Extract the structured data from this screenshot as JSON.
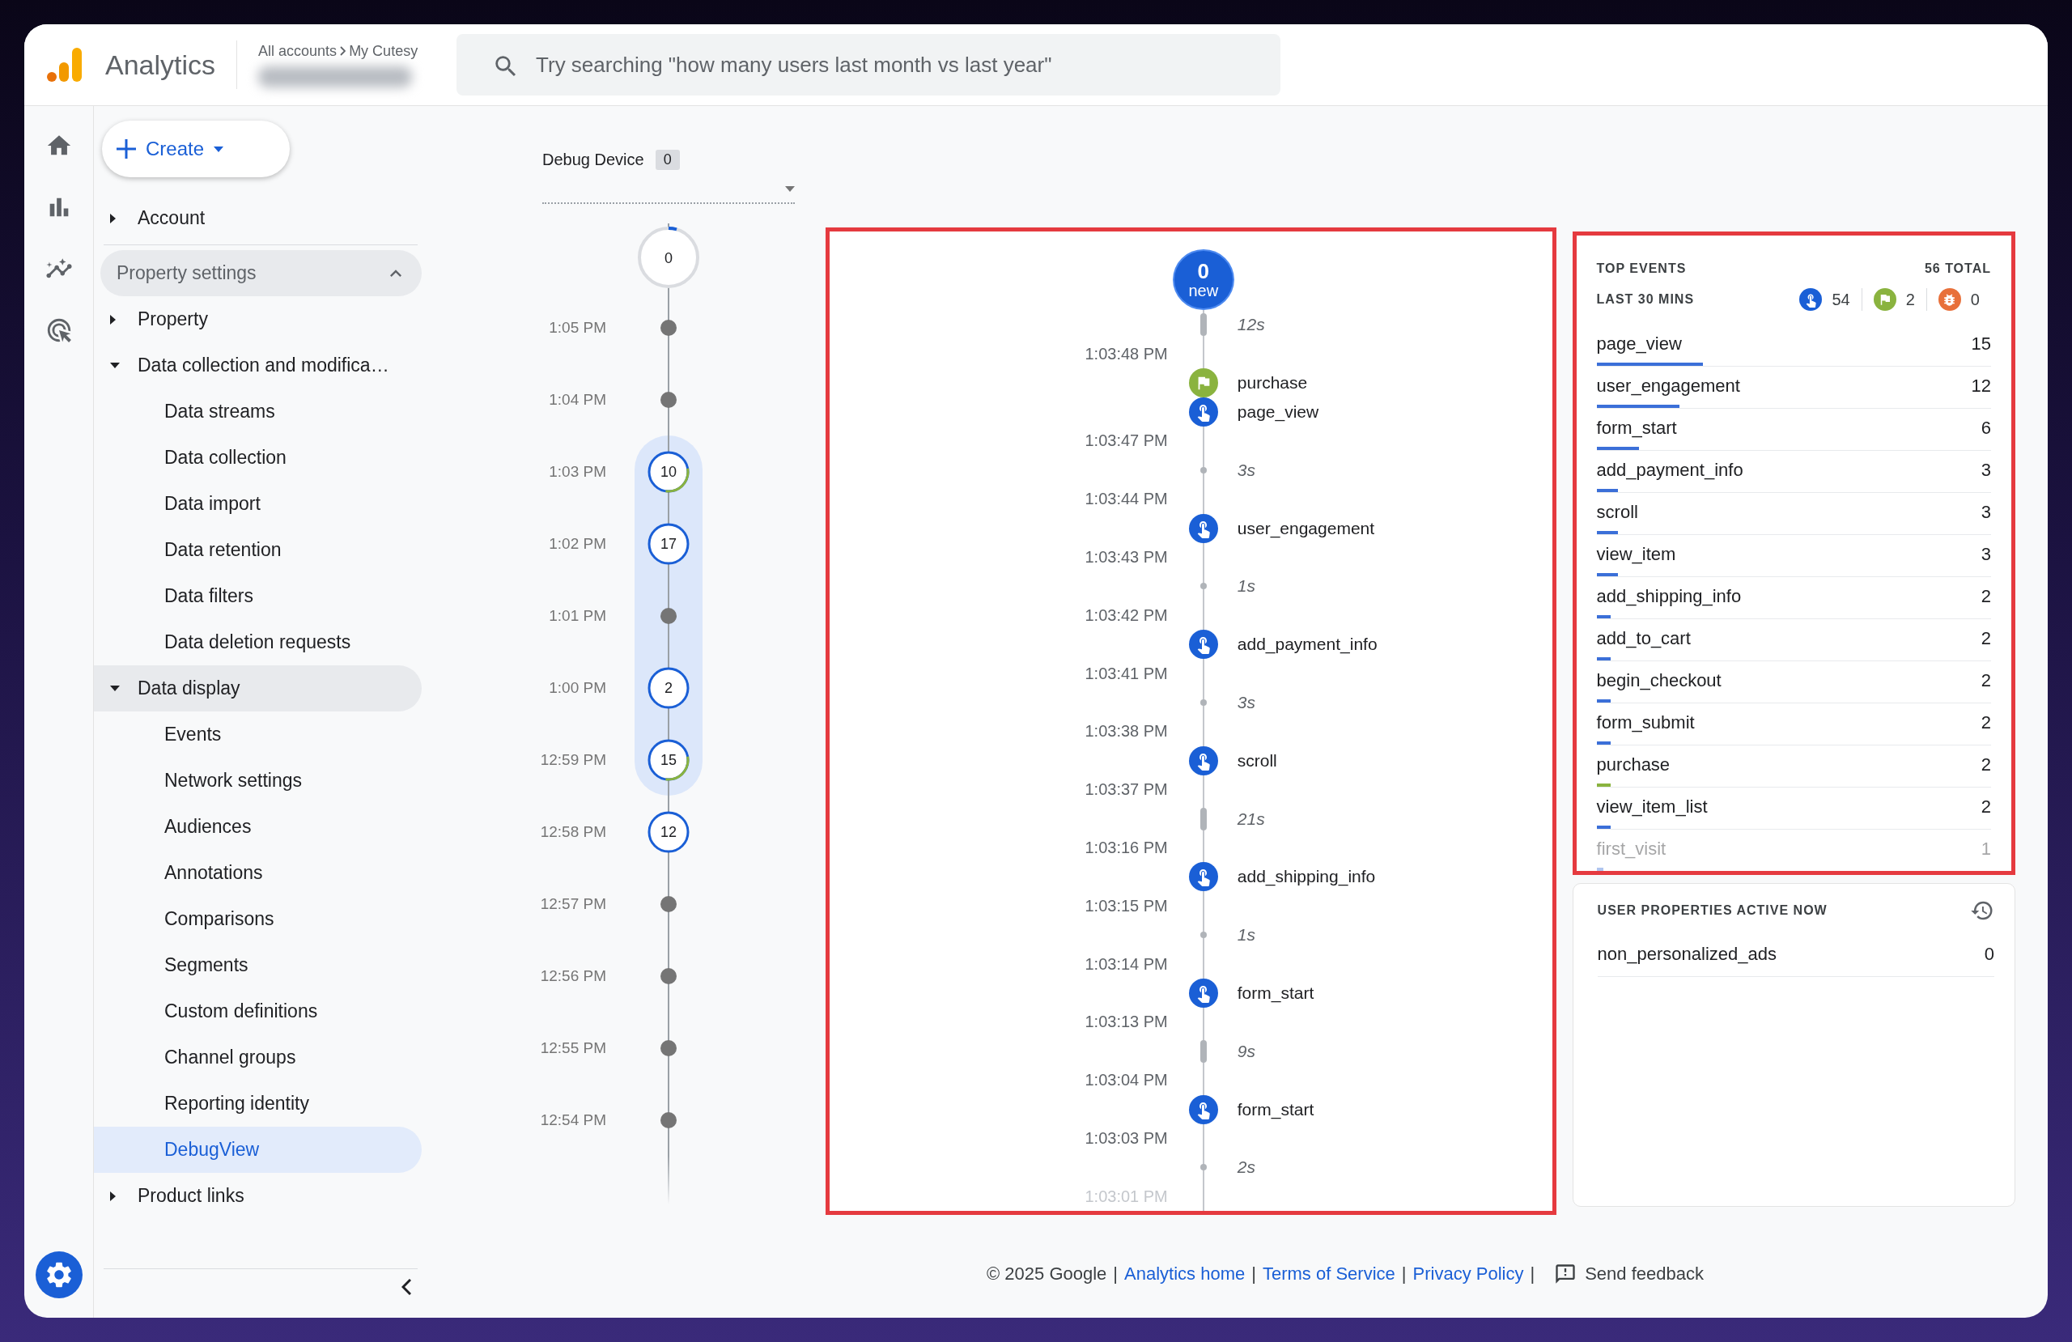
{
  "header": {
    "product": "Analytics",
    "breadcrumb": [
      "All accounts",
      "My Cutesy"
    ],
    "search": {
      "placeholder": "Try searching \"how many users last month vs last year\""
    }
  },
  "sidebar": {
    "create_button": "Create",
    "items": [
      {
        "label": "Account",
        "kind": "node",
        "expanded": false
      },
      {
        "label": "Property settings",
        "kind": "section",
        "expanded": true,
        "children": [
          {
            "label": "Property",
            "kind": "node",
            "expanded": false
          },
          {
            "label": "Data collection and modifica…",
            "kind": "node",
            "expanded": true,
            "children": [
              {
                "label": "Data streams",
                "kind": "leaf",
                "selected": false
              },
              {
                "label": "Data collection",
                "kind": "leaf",
                "selected": false
              },
              {
                "label": "Data import",
                "kind": "leaf",
                "selected": false
              },
              {
                "label": "Data retention",
                "kind": "leaf",
                "selected": false
              },
              {
                "label": "Data filters",
                "kind": "leaf",
                "selected": false
              },
              {
                "label": "Data deletion requests",
                "kind": "leaf",
                "selected": false
              }
            ]
          },
          {
            "label": "Data display",
            "kind": "node",
            "expanded": true,
            "highlighted": true,
            "children": [
              {
                "label": "Events",
                "kind": "leaf",
                "selected": false
              },
              {
                "label": "Network settings",
                "kind": "leaf",
                "selected": false
              },
              {
                "label": "Audiences",
                "kind": "leaf",
                "selected": false
              },
              {
                "label": "Annotations",
                "kind": "leaf",
                "selected": false
              },
              {
                "label": "Comparisons",
                "kind": "leaf",
                "selected": false
              },
              {
                "label": "Segments",
                "kind": "leaf",
                "selected": false
              },
              {
                "label": "Custom definitions",
                "kind": "leaf",
                "selected": false
              },
              {
                "label": "Channel groups",
                "kind": "leaf",
                "selected": false
              },
              {
                "label": "Reporting identity",
                "kind": "leaf",
                "selected": false
              },
              {
                "label": "DebugView",
                "kind": "leaf",
                "selected": true
              }
            ]
          },
          {
            "label": "Product links",
            "kind": "node",
            "expanded": false
          }
        ]
      }
    ]
  },
  "timeline": {
    "device_label": "Debug Device",
    "device_count": "0",
    "current": "0",
    "rows": [
      {
        "time": "1:05 PM",
        "kind": "dot",
        "highlighted": false
      },
      {
        "time": "1:04 PM",
        "kind": "dot",
        "highlighted": false
      },
      {
        "time": "1:03 PM",
        "kind": "count",
        "count": "10",
        "conversion": true,
        "highlighted": true
      },
      {
        "time": "1:02 PM",
        "kind": "count",
        "count": "17",
        "conversion": false,
        "highlighted": true
      },
      {
        "time": "1:01 PM",
        "kind": "dot",
        "highlighted": true
      },
      {
        "time": "1:00 PM",
        "kind": "count",
        "count": "2",
        "conversion": false,
        "highlighted": true
      },
      {
        "time": "12:59 PM",
        "kind": "count",
        "count": "15",
        "conversion": true,
        "highlighted": true
      },
      {
        "time": "12:58 PM",
        "kind": "count",
        "count": "12",
        "conversion": false,
        "highlighted": false
      },
      {
        "time": "12:57 PM",
        "kind": "dot",
        "highlighted": false
      },
      {
        "time": "12:56 PM",
        "kind": "dot",
        "highlighted": false
      },
      {
        "time": "12:55 PM",
        "kind": "dot",
        "highlighted": false
      },
      {
        "time": "12:54 PM",
        "kind": "dot",
        "highlighted": false
      }
    ]
  },
  "stream": {
    "new_count": "0",
    "new_label": "new",
    "entries": [
      {
        "kind": "gap",
        "text": "12s",
        "long": true
      },
      {
        "kind": "time",
        "text": "1:03:48 PM",
        "faded": false
      },
      {
        "kind": "conversion",
        "text": "purchase"
      },
      {
        "kind": "event",
        "text": "page_view"
      },
      {
        "kind": "time",
        "text": "1:03:47 PM",
        "faded": false
      },
      {
        "kind": "gap",
        "text": "3s",
        "long": false
      },
      {
        "kind": "time",
        "text": "1:03:44 PM",
        "faded": false
      },
      {
        "kind": "event",
        "text": "user_engagement"
      },
      {
        "kind": "time",
        "text": "1:03:43 PM",
        "faded": false
      },
      {
        "kind": "gap",
        "text": "1s",
        "long": false
      },
      {
        "kind": "time",
        "text": "1:03:42 PM",
        "faded": false
      },
      {
        "kind": "event",
        "text": "add_payment_info"
      },
      {
        "kind": "time",
        "text": "1:03:41 PM",
        "faded": false
      },
      {
        "kind": "gap",
        "text": "3s",
        "long": false
      },
      {
        "kind": "time",
        "text": "1:03:38 PM",
        "faded": false
      },
      {
        "kind": "event",
        "text": "scroll"
      },
      {
        "kind": "time",
        "text": "1:03:37 PM",
        "faded": false
      },
      {
        "kind": "gap",
        "text": "21s",
        "long": true
      },
      {
        "kind": "time",
        "text": "1:03:16 PM",
        "faded": false
      },
      {
        "kind": "event",
        "text": "add_shipping_info"
      },
      {
        "kind": "time",
        "text": "1:03:15 PM",
        "faded": false
      },
      {
        "kind": "gap",
        "text": "1s",
        "long": false
      },
      {
        "kind": "time",
        "text": "1:03:14 PM",
        "faded": false
      },
      {
        "kind": "event",
        "text": "form_start"
      },
      {
        "kind": "time",
        "text": "1:03:13 PM",
        "faded": false
      },
      {
        "kind": "gap",
        "text": "9s",
        "long": true
      },
      {
        "kind": "time",
        "text": "1:03:04 PM",
        "faded": false
      },
      {
        "kind": "event",
        "text": "form_start"
      },
      {
        "kind": "time",
        "text": "1:03:03 PM",
        "faded": false
      },
      {
        "kind": "gap",
        "text": "2s",
        "long": false
      },
      {
        "kind": "time",
        "text": "1:03:01 PM",
        "faded": true
      }
    ]
  },
  "top_events": {
    "title": "TOP EVENTS",
    "total": "56 TOTAL",
    "period": "LAST 30 MINS",
    "summary": [
      {
        "kind": "event",
        "count": "54"
      },
      {
        "kind": "conversion",
        "count": "2"
      },
      {
        "kind": "error",
        "count": "0"
      }
    ],
    "rows": [
      {
        "name": "page_view",
        "count": "15",
        "level": 0.27,
        "kind": "event",
        "faded": false
      },
      {
        "name": "user_engagement",
        "count": "12",
        "level": 0.21,
        "kind": "event",
        "faded": false
      },
      {
        "name": "form_start",
        "count": "6",
        "level": 0.107,
        "kind": "event",
        "faded": false
      },
      {
        "name": "add_payment_info",
        "count": "3",
        "level": 0.054,
        "kind": "event",
        "faded": false
      },
      {
        "name": "scroll",
        "count": "3",
        "level": 0.054,
        "kind": "event",
        "faded": false
      },
      {
        "name": "view_item",
        "count": "3",
        "level": 0.054,
        "kind": "event",
        "faded": false
      },
      {
        "name": "add_shipping_info",
        "count": "2",
        "level": 0.036,
        "kind": "event",
        "faded": false
      },
      {
        "name": "add_to_cart",
        "count": "2",
        "level": 0.036,
        "kind": "event",
        "faded": false
      },
      {
        "name": "begin_checkout",
        "count": "2",
        "level": 0.036,
        "kind": "event",
        "faded": false
      },
      {
        "name": "form_submit",
        "count": "2",
        "level": 0.036,
        "kind": "event",
        "faded": false
      },
      {
        "name": "purchase",
        "count": "2",
        "level": 0.036,
        "kind": "conversion",
        "faded": false
      },
      {
        "name": "view_item_list",
        "count": "2",
        "level": 0.036,
        "kind": "event",
        "faded": false
      },
      {
        "name": "first_visit",
        "count": "1",
        "level": 0.018,
        "kind": "event",
        "faded": true
      }
    ]
  },
  "user_properties": {
    "title": "USER PROPERTIES ACTIVE NOW",
    "rows": [
      {
        "name": "non_personalized_ads",
        "value": "0"
      }
    ]
  },
  "footer": [
    {
      "kind": "text",
      "text": "© 2025 Google"
    },
    {
      "kind": "separator",
      "text": "|"
    },
    {
      "kind": "link",
      "text": "Analytics home"
    },
    {
      "kind": "separator",
      "text": "|"
    },
    {
      "kind": "link",
      "text": "Terms of Service"
    },
    {
      "kind": "separator",
      "text": "|"
    },
    {
      "kind": "link",
      "text": "Privacy Policy"
    },
    {
      "kind": "separator",
      "text": "|"
    },
    {
      "kind": "feedback",
      "text": "Send feedback"
    }
  ]
}
